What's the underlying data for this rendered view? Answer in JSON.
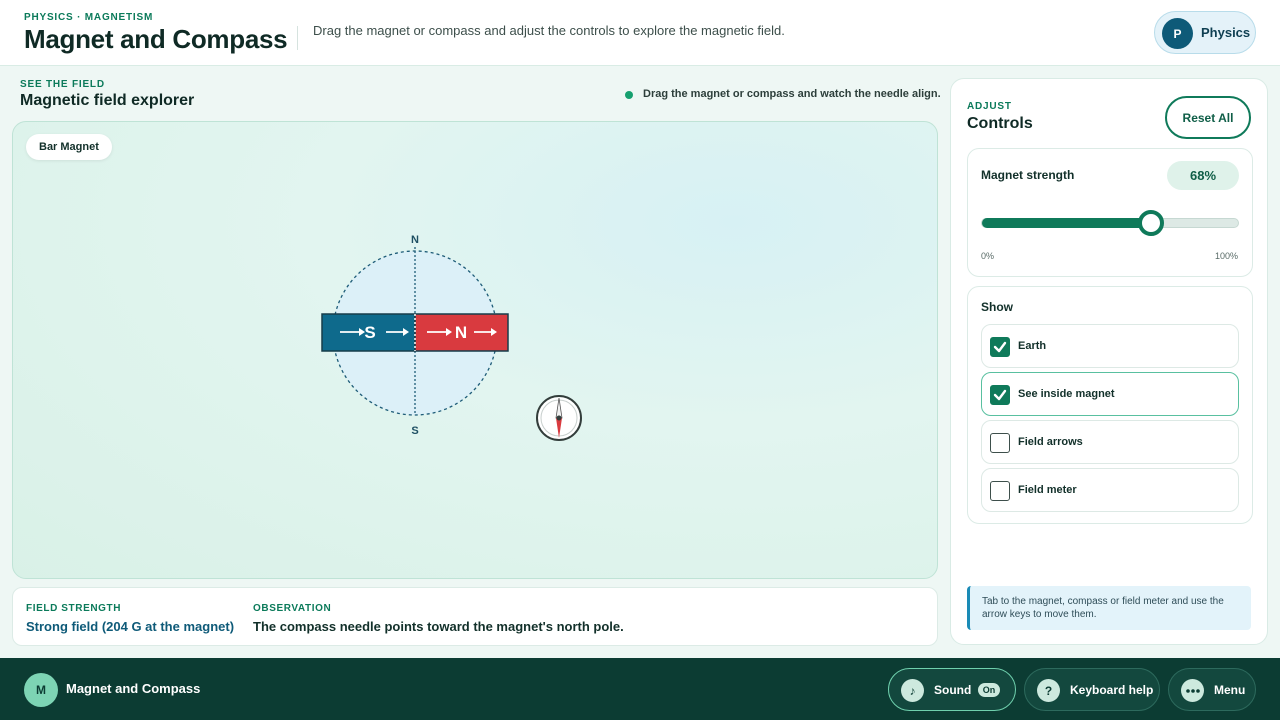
{
  "header": {
    "eyebrow": "PHYSICS · MAGNETISM",
    "title": "Magnet and Compass",
    "instruction": "Drag the magnet or compass and adjust the controls to explore the magnetic field.",
    "subject": {
      "initial": "P",
      "label": "Physics"
    }
  },
  "explorer": {
    "eyebrow": "SEE THE FIELD",
    "title": "Magnetic field explorer",
    "hint": "Drag the magnet or compass and watch the needle align.",
    "magnet_tag": "Bar Magnet",
    "magnet": {
      "south_label": "S",
      "north_label": "N",
      "arrow": "→"
    },
    "field_circle": {
      "top_label": "N",
      "bottom_label": "S"
    }
  },
  "info": {
    "field_strength_label": "FIELD STRENGTH",
    "field_strength_value": "Strong field (204 G at the magnet)",
    "observation_label": "OBSERVATION",
    "observation_value": "The compass needle points toward the magnet's north pole."
  },
  "controls": {
    "eyebrow": "ADJUST",
    "title": "Controls",
    "reset_label": "Reset All",
    "strength": {
      "label": "Magnet strength",
      "value_text": "68%",
      "value": 0.66,
      "min_label": "0%",
      "max_label": "100%"
    },
    "show": {
      "label": "Show",
      "options": [
        {
          "label": "Earth",
          "checked": true
        },
        {
          "label": "See inside magnet",
          "checked": true
        },
        {
          "label": "Field arrows",
          "checked": false
        },
        {
          "label": "Field meter",
          "checked": false
        }
      ]
    },
    "keyboard_note": "Tab to the magnet, compass or field meter and use the arrow keys to move them."
  },
  "footer": {
    "logo_initial": "M",
    "title": "Magnet and Compass",
    "sound": {
      "label": "Sound",
      "state": "On",
      "icon": "music-note-icon"
    },
    "keyboard_help": {
      "label": "Keyboard help",
      "icon": "question-icon"
    },
    "menu": {
      "label": "Menu",
      "icon": "more-dots-icon"
    }
  },
  "colors": {
    "accent": "#0f7a5a",
    "south_pole": "#0e6a8c",
    "north_pole": "#d93a3f",
    "footer": "#0c3c33"
  }
}
